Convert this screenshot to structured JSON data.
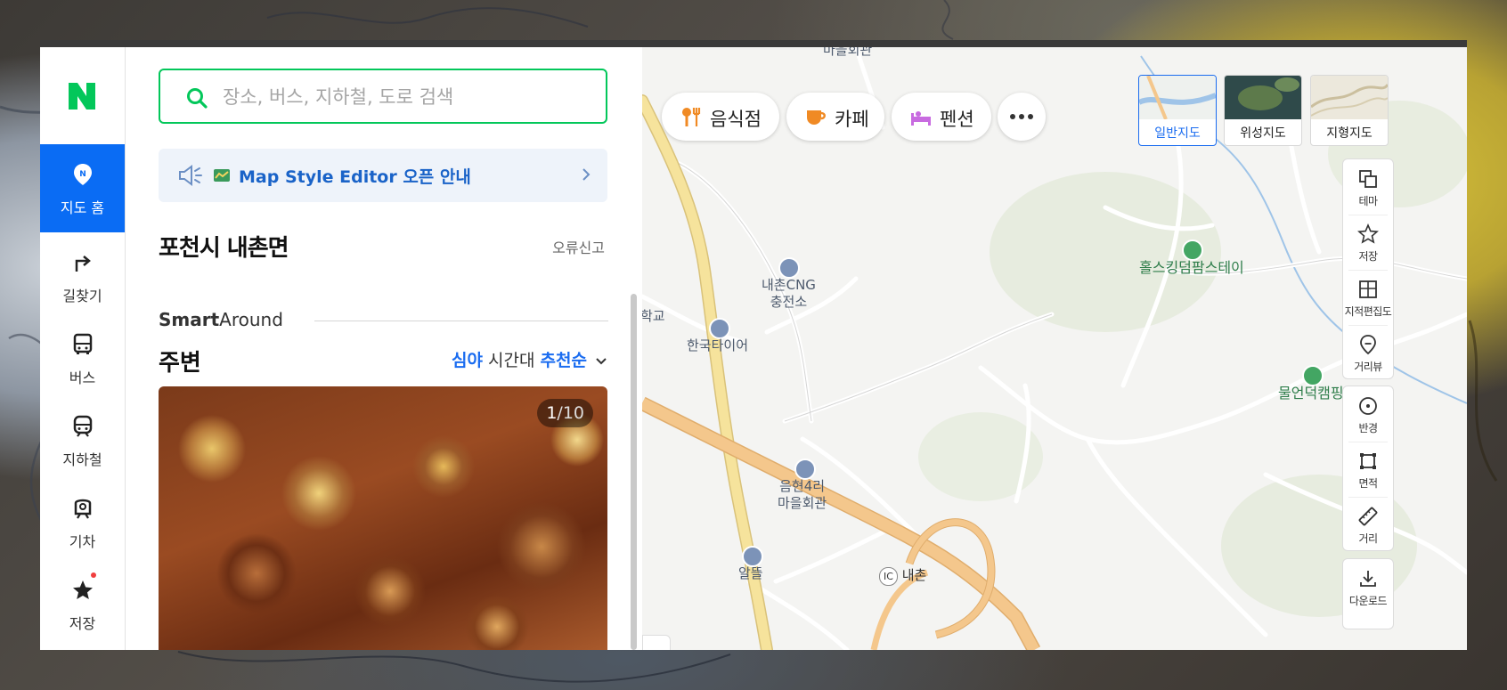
{
  "rail": {
    "logo": "N",
    "items": [
      {
        "label": "지도 홈",
        "icon": "map-pin-icon",
        "active": true
      },
      {
        "label": "길찾기",
        "icon": "directions-icon",
        "active": false
      },
      {
        "label": "버스",
        "icon": "bus-icon",
        "active": false
      },
      {
        "label": "지하철",
        "icon": "subway-icon",
        "active": false
      },
      {
        "label": "기차",
        "icon": "train-icon",
        "active": false
      },
      {
        "label": "저장",
        "icon": "star-icon",
        "active": false
      }
    ]
  },
  "panel": {
    "search_placeholder": "장소, 버스, 지하철, 도로 검색",
    "notice": "Map Style Editor 오픈 안내",
    "location_title": "포천시 내촌면",
    "report_label": "오류신고",
    "smart_around_bold": "Smart",
    "smart_around_rest": "Around",
    "nearby_title": "주변",
    "filter_time": "심야",
    "filter_time_suffix": "시간대",
    "filter_sort": "추천순",
    "photo_counter_current": "1",
    "photo_counter_total": "/10"
  },
  "map": {
    "categories": [
      {
        "label": "음식점",
        "icon": "restaurant-icon"
      },
      {
        "label": "카페",
        "icon": "cafe-icon"
      },
      {
        "label": "펜션",
        "icon": "pension-icon"
      }
    ],
    "more_label": "more",
    "map_types": [
      {
        "label": "일반지도",
        "active": true
      },
      {
        "label": "위성지도",
        "active": false
      },
      {
        "label": "지형지도",
        "active": false
      }
    ],
    "tools_top": [
      {
        "label": "테마",
        "icon": "layers-icon"
      },
      {
        "label": "저장",
        "icon": "star-outline-icon"
      },
      {
        "label": "지적편집도",
        "icon": "cadastral-icon"
      },
      {
        "label": "거리뷰",
        "icon": "street-view-icon"
      }
    ],
    "tools_mid": [
      {
        "label": "반경",
        "icon": "radius-icon"
      },
      {
        "label": "면적",
        "icon": "area-icon"
      },
      {
        "label": "거리",
        "icon": "ruler-icon"
      }
    ],
    "tools_bottom": [
      {
        "label": "다운로드",
        "icon": "download-icon"
      }
    ],
    "labels": {
      "village_hall_top": "마을회관",
      "cng_line1": "내촌CNG",
      "cng_line2": "충전소",
      "school": "학교",
      "tire": "한국타이어",
      "eumhyeon_line1": "음현4리",
      "eumhyeon_line2": "마을회관",
      "altteul": "알뜰",
      "ic_badge": "IC",
      "ic_name": "내촌",
      "camp1": "홀스킹덤팜스테이",
      "camp2": "물언덕캠핑"
    }
  },
  "colors": {
    "naver_green": "#03c75a",
    "active_blue": "#0a6cf4",
    "link_blue": "#1a6cf0",
    "highway_orange": "#f4c78c",
    "road_yellow": "#f6e39c"
  }
}
